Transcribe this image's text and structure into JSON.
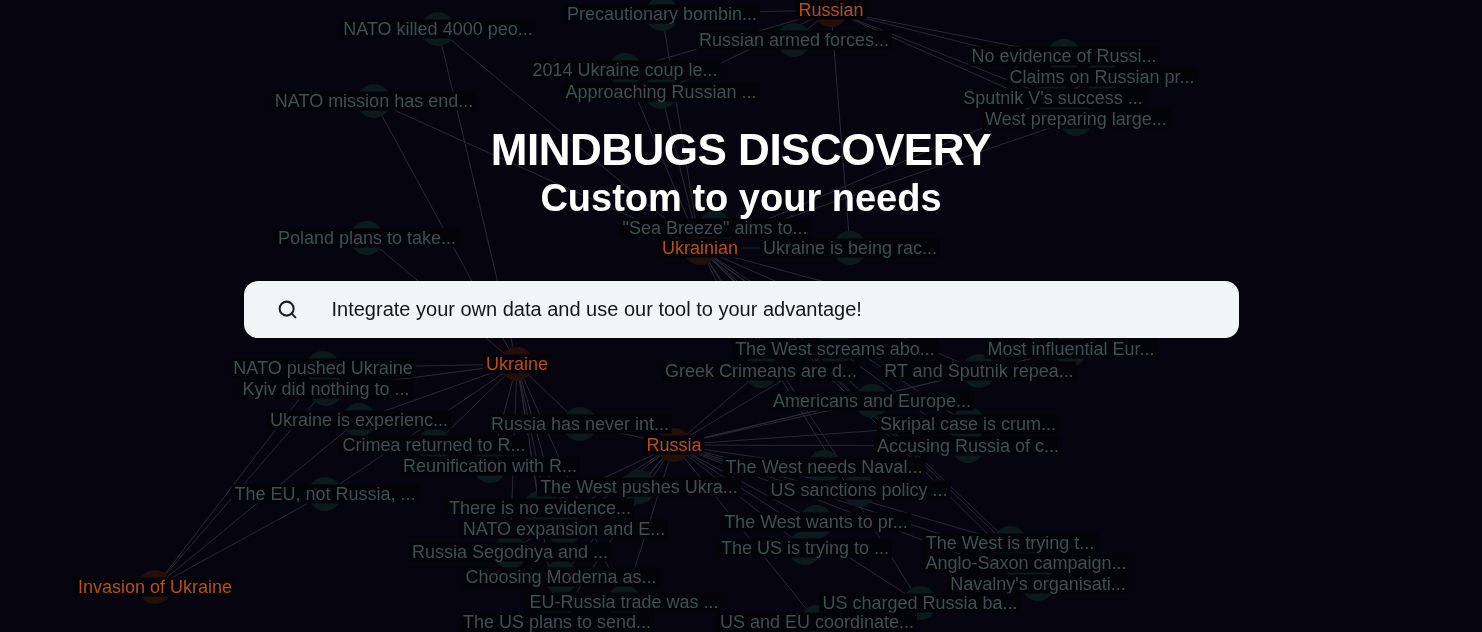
{
  "hero": {
    "title": "MINDBUGS DISCOVERY",
    "subtitle": "Custom to your needs"
  },
  "search": {
    "placeholder": "Integrate your own data and use our tool to your advantage!"
  },
  "graph": {
    "nodes": [
      {
        "label": "NATO killed 4000 peo...",
        "kind": "claim"
      },
      {
        "label": "Precautionary bombin...",
        "kind": "claim"
      },
      {
        "label": "Russian",
        "kind": "topic"
      },
      {
        "label": "Russian armed forces...",
        "kind": "claim"
      },
      {
        "label": "No evidence of Russi...",
        "kind": "claim"
      },
      {
        "label": "2014 Ukraine coup le...",
        "kind": "claim"
      },
      {
        "label": "Claims on Russian pr...",
        "kind": "claim"
      },
      {
        "label": "NATO mission has end...",
        "kind": "claim"
      },
      {
        "label": "Approaching Russian ...",
        "kind": "claim"
      },
      {
        "label": "Sputnik V's success ...",
        "kind": "claim"
      },
      {
        "label": "West preparing large...",
        "kind": "claim"
      },
      {
        "label": "Poland plans to take...",
        "kind": "claim"
      },
      {
        "label": "\"Sea Breeze\" aims to...",
        "kind": "claim"
      },
      {
        "label": "Ukrainian",
        "kind": "topic"
      },
      {
        "label": "Ukraine is being rac...",
        "kind": "claim"
      },
      {
        "label": "The West screams abo...",
        "kind": "claim"
      },
      {
        "label": "Most influential Eur...",
        "kind": "claim"
      },
      {
        "label": "NATO pushed Ukraine",
        "kind": "claim"
      },
      {
        "label": "Ukraine",
        "kind": "topic"
      },
      {
        "label": "Greek Crimeans are d...",
        "kind": "claim"
      },
      {
        "label": "RT and Sputnik repea...",
        "kind": "claim"
      },
      {
        "label": "Kyiv did nothing to ...",
        "kind": "claim"
      },
      {
        "label": "Americans and Europe...",
        "kind": "claim"
      },
      {
        "label": "Ukraine is experienc...",
        "kind": "claim"
      },
      {
        "label": "Russia has never int...",
        "kind": "claim"
      },
      {
        "label": "Skripal case is crum...",
        "kind": "claim"
      },
      {
        "label": "Crimea returned to R...",
        "kind": "claim"
      },
      {
        "label": "Russia",
        "kind": "topic"
      },
      {
        "label": "Accusing Russia of c...",
        "kind": "claim"
      },
      {
        "label": "Reunification with R...",
        "kind": "claim"
      },
      {
        "label": "The West needs Naval...",
        "kind": "claim"
      },
      {
        "label": "The EU, not Russia, ...",
        "kind": "claim"
      },
      {
        "label": "The West pushes Ukra...",
        "kind": "claim"
      },
      {
        "label": "US sanctions policy ...",
        "kind": "claim"
      },
      {
        "label": "There is no evidence...",
        "kind": "claim"
      },
      {
        "label": "NATO expansion and E...",
        "kind": "claim"
      },
      {
        "label": "The West wants to pr...",
        "kind": "claim"
      },
      {
        "label": "Russia Segodnya and ...",
        "kind": "claim"
      },
      {
        "label": "The US is trying to ...",
        "kind": "claim"
      },
      {
        "label": "The West is trying t...",
        "kind": "claim"
      },
      {
        "label": "Anglo-Saxon campaign...",
        "kind": "claim"
      },
      {
        "label": "Invasion of Ukraine",
        "kind": "topic"
      },
      {
        "label": "Choosing Moderna as...",
        "kind": "claim"
      },
      {
        "label": "Navalny's organisati...",
        "kind": "claim"
      },
      {
        "label": "EU-Russia trade was ...",
        "kind": "claim"
      },
      {
        "label": "US charged Russia ba...",
        "kind": "claim"
      },
      {
        "label": "The US plans to send...",
        "kind": "claim"
      },
      {
        "label": "US and EU coordinate...",
        "kind": "claim"
      }
    ]
  }
}
